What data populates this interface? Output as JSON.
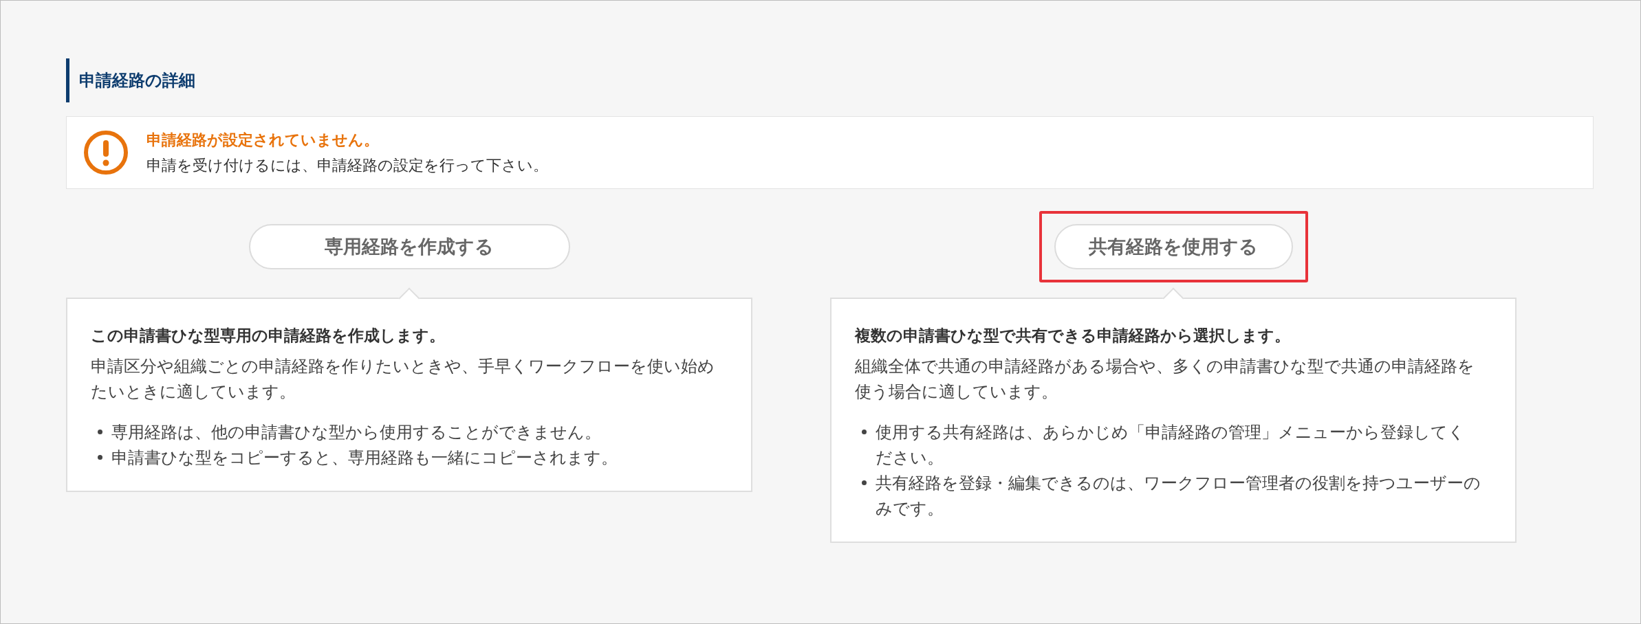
{
  "section_title": "申請経路の詳細",
  "alert": {
    "title": "申請経路が設定されていません。",
    "message": "申請を受け付けるには、申請経路の設定を行って下さい。"
  },
  "options": [
    {
      "button": "専用経路を作成する",
      "highlighted": false,
      "heading": "この申請書ひな型専用の申請経路を作成します。",
      "description": "申請区分や組織ごとの申請経路を作りたいときや、手早くワークフローを使い始めたいときに適しています。",
      "notes": [
        "専用経路は、他の申請書ひな型から使用することができません。",
        "申請書ひな型をコピーすると、専用経路も一緒にコピーされます。"
      ]
    },
    {
      "button": "共有経路を使用する",
      "highlighted": true,
      "heading": "複数の申請書ひな型で共有できる申請経路から選択します。",
      "description": "組織全体で共通の申請経路がある場合や、多くの申請書ひな型で共通の申請経路を使う場合に適しています。",
      "notes": [
        "使用する共有経路は、あらかじめ「申請経路の管理」メニューから登録してください。",
        "共有経路を登録・編集できるのは、ワークフロー管理者の役割を持つユーザーのみです。"
      ]
    }
  ]
}
